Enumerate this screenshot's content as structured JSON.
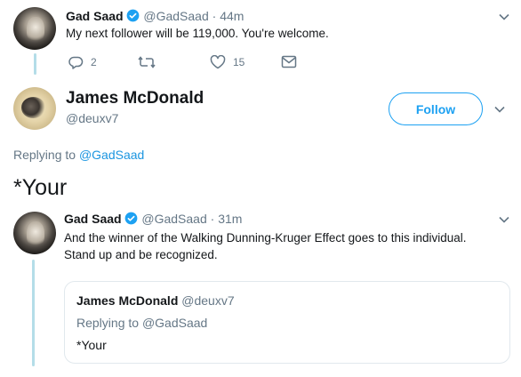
{
  "tweet1": {
    "name": "Gad Saad",
    "handle": "@GadSaad",
    "time": "· 44m",
    "text": "My next follower will be 119,000.  You're welcome.",
    "reply_count": "2",
    "like_count": "15"
  },
  "reply": {
    "name": "James McDonald",
    "handle": "@deuxv7",
    "follow_label": "Follow",
    "replying_prefix": "Replying to",
    "replying_to": "@GadSaad",
    "text": "*Your"
  },
  "tweet2": {
    "name": "Gad Saad",
    "handle": "@GadSaad",
    "time": "· 31m",
    "text_line1": "And the winner of the Walking Dunning-Kruger Effect goes to this individual.",
    "text_line2": "Stand up and be recognized."
  },
  "quoted": {
    "name": "James McDonald",
    "handle": "@deuxv7",
    "replying_prefix": "Replying to",
    "replying_to": "@GadSaad",
    "text": "*Your"
  },
  "colors": {
    "accent": "#1da1f2",
    "link": "#1b95e0",
    "muted": "#657786",
    "thread_line": "#b4dde8"
  },
  "icons": [
    "verified-icon",
    "chevron-down-icon",
    "reply-icon",
    "retweet-icon",
    "like-icon",
    "dm-icon"
  ]
}
